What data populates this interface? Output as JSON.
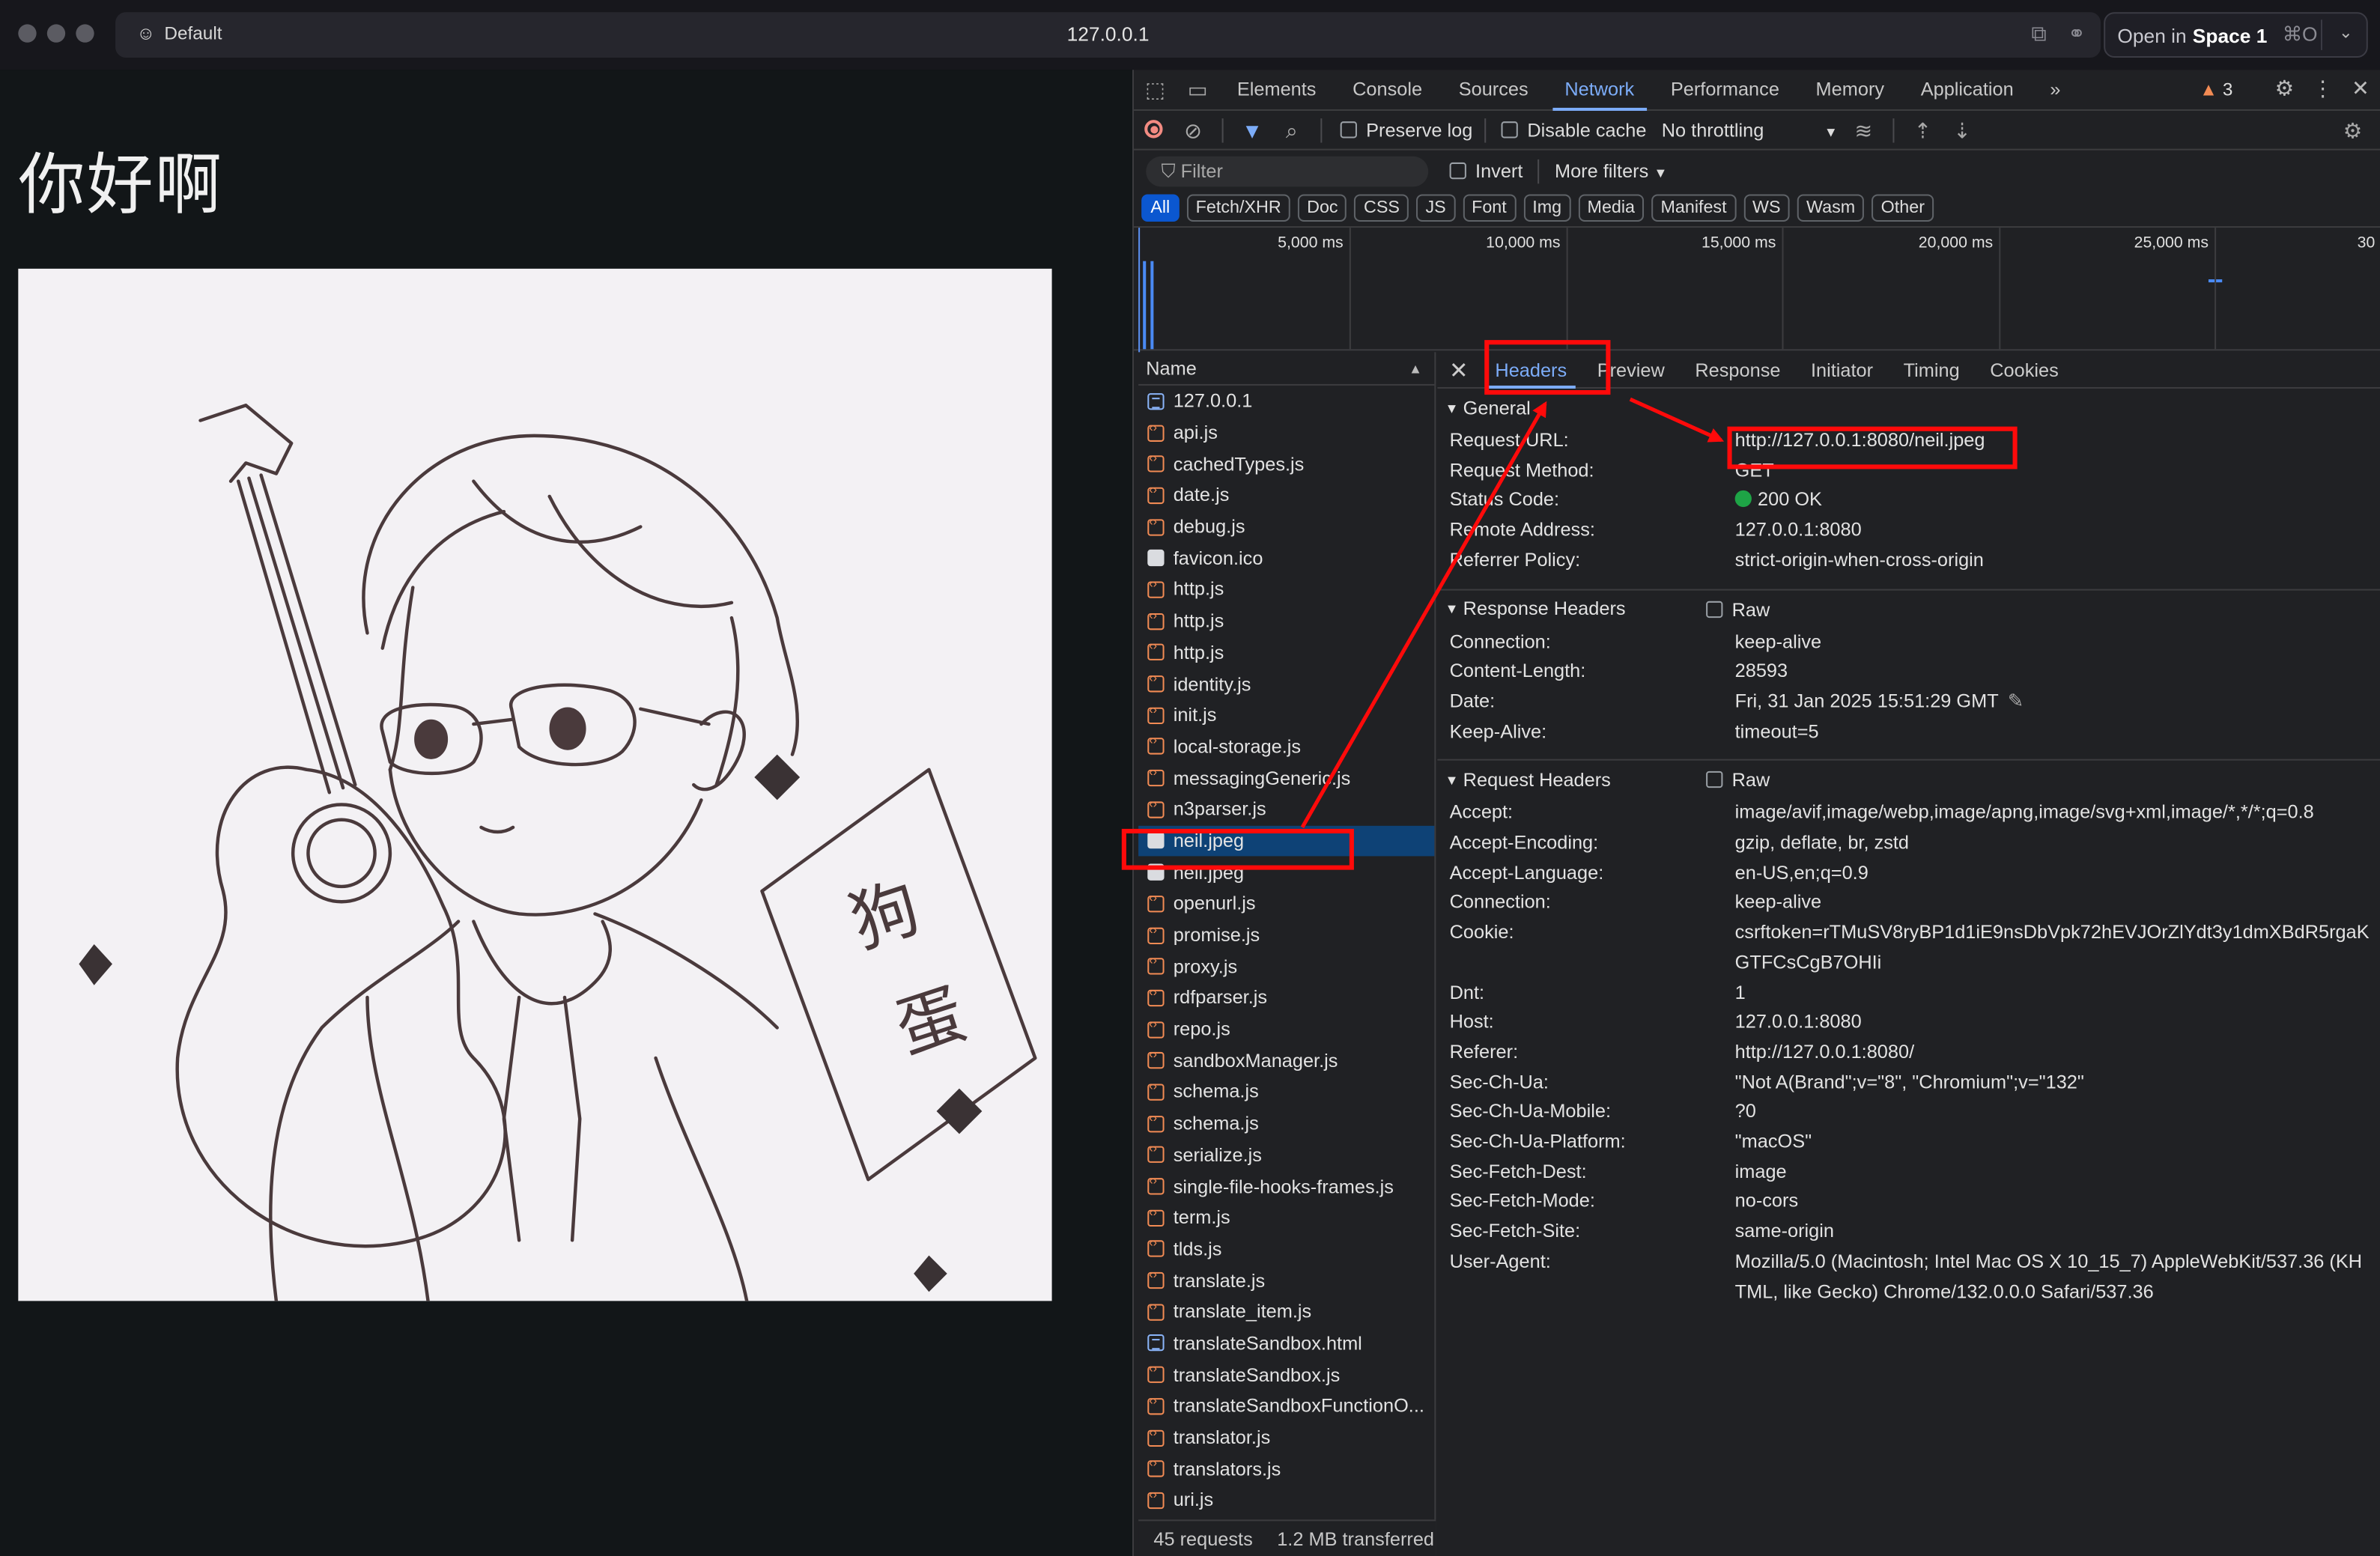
{
  "browser": {
    "profile": "Default",
    "url": "127.0.0.1",
    "open_in_label": "Open in",
    "open_in_space": "Space 1",
    "open_in_shortcut": "⌘O"
  },
  "page": {
    "heading": "你好啊",
    "artwork_text": "狗蛋"
  },
  "devtools": {
    "tabs": [
      "Elements",
      "Console",
      "Sources",
      "Network",
      "Performance",
      "Memory",
      "Application"
    ],
    "active_tab": "Network",
    "issues_count": "3",
    "toolbar": {
      "preserve_log": "Preserve log",
      "disable_cache": "Disable cache",
      "throttling": "No throttling"
    },
    "filter": {
      "placeholder": "Filter",
      "invert": "Invert",
      "more_filters": "More filters"
    },
    "type_filters": [
      "All",
      "Fetch/XHR",
      "Doc",
      "CSS",
      "JS",
      "Font",
      "Img",
      "Media",
      "Manifest",
      "WS",
      "Wasm",
      "Other"
    ],
    "timeline_ticks": [
      "5,000 ms",
      "10,000 ms",
      "15,000 ms",
      "20,000 ms",
      "25,000 ms",
      "30"
    ],
    "name_header": "Name",
    "requests": [
      {
        "name": "127.0.0.1",
        "type": "doc"
      },
      {
        "name": "api.js",
        "type": "js"
      },
      {
        "name": "cachedTypes.js",
        "type": "js"
      },
      {
        "name": "date.js",
        "type": "js"
      },
      {
        "name": "debug.js",
        "type": "js"
      },
      {
        "name": "favicon.ico",
        "type": "img"
      },
      {
        "name": "http.js",
        "type": "js"
      },
      {
        "name": "http.js",
        "type": "js"
      },
      {
        "name": "http.js",
        "type": "js"
      },
      {
        "name": "identity.js",
        "type": "js"
      },
      {
        "name": "init.js",
        "type": "js"
      },
      {
        "name": "local-storage.js",
        "type": "js"
      },
      {
        "name": "messagingGeneric.js",
        "type": "js"
      },
      {
        "name": "n3parser.js",
        "type": "js"
      },
      {
        "name": "neil.jpeg",
        "type": "img",
        "selected": true
      },
      {
        "name": "neil.jpeg",
        "type": "img"
      },
      {
        "name": "openurl.js",
        "type": "js"
      },
      {
        "name": "promise.js",
        "type": "js"
      },
      {
        "name": "proxy.js",
        "type": "js"
      },
      {
        "name": "rdfparser.js",
        "type": "js"
      },
      {
        "name": "repo.js",
        "type": "js"
      },
      {
        "name": "sandboxManager.js",
        "type": "js"
      },
      {
        "name": "schema.js",
        "type": "js"
      },
      {
        "name": "schema.js",
        "type": "js"
      },
      {
        "name": "serialize.js",
        "type": "js"
      },
      {
        "name": "single-file-hooks-frames.js",
        "type": "js"
      },
      {
        "name": "term.js",
        "type": "js"
      },
      {
        "name": "tlds.js",
        "type": "js"
      },
      {
        "name": "translate.js",
        "type": "js"
      },
      {
        "name": "translate_item.js",
        "type": "js"
      },
      {
        "name": "translateSandbox.html",
        "type": "doc"
      },
      {
        "name": "translateSandbox.js",
        "type": "js"
      },
      {
        "name": "translateSandboxFunctionO...",
        "type": "js"
      },
      {
        "name": "translator.js",
        "type": "js"
      },
      {
        "name": "translators.js",
        "type": "js"
      },
      {
        "name": "uri.js",
        "type": "js"
      }
    ],
    "summary": {
      "requests": "45 requests",
      "transferred": "1.2 MB transferred"
    },
    "detail_tabs": [
      "Headers",
      "Preview",
      "Response",
      "Initiator",
      "Timing",
      "Cookies"
    ],
    "general": {
      "title": "General",
      "rows": [
        {
          "k": "Request URL:",
          "v": "http://127.0.0.1:8080/neil.jpeg"
        },
        {
          "k": "Request Method:",
          "v": "GET"
        },
        {
          "k": "Status Code:",
          "v": "200 OK"
        },
        {
          "k": "Remote Address:",
          "v": "127.0.0.1:8080"
        },
        {
          "k": "Referrer Policy:",
          "v": "strict-origin-when-cross-origin"
        }
      ]
    },
    "response_headers": {
      "title": "Response Headers",
      "raw": "Raw",
      "rows": [
        {
          "k": "Connection:",
          "v": "keep-alive"
        },
        {
          "k": "Content-Length:",
          "v": "28593"
        },
        {
          "k": "Date:",
          "v": "Fri, 31 Jan 2025 15:51:29 GMT"
        },
        {
          "k": "Keep-Alive:",
          "v": "timeout=5"
        }
      ]
    },
    "request_headers": {
      "title": "Request Headers",
      "raw": "Raw",
      "rows": [
        {
          "k": "Accept:",
          "v": "image/avif,image/webp,image/apng,image/svg+xml,image/*,*/*;q=0.8"
        },
        {
          "k": "Accept-Encoding:",
          "v": "gzip, deflate, br, zstd"
        },
        {
          "k": "Accept-Language:",
          "v": "en-US,en;q=0.9"
        },
        {
          "k": "Connection:",
          "v": "keep-alive"
        },
        {
          "k": "Cookie:",
          "v": "csrftoken=rTMuSV8ryBP1d1iE9nsDbVpk72hEVJOrZlYdt3y1dmXBdR5rgaKGTFCsCgB7OHIi"
        },
        {
          "k": "Dnt:",
          "v": "1"
        },
        {
          "k": "Host:",
          "v": "127.0.0.1:8080"
        },
        {
          "k": "Referer:",
          "v": "http://127.0.0.1:8080/"
        },
        {
          "k": "Sec-Ch-Ua:",
          "v": "\"Not A(Brand\";v=\"8\", \"Chromium\";v=\"132\""
        },
        {
          "k": "Sec-Ch-Ua-Mobile:",
          "v": "?0"
        },
        {
          "k": "Sec-Ch-Ua-Platform:",
          "v": "\"macOS\""
        },
        {
          "k": "Sec-Fetch-Dest:",
          "v": "image"
        },
        {
          "k": "Sec-Fetch-Mode:",
          "v": "no-cors"
        },
        {
          "k": "Sec-Fetch-Site:",
          "v": "same-origin"
        },
        {
          "k": "User-Agent:",
          "v": "Mozilla/5.0 (Macintosh; Intel Mac OS X 10_15_7) AppleWebKit/537.36 (KHTML, like Gecko) Chrome/132.0.0.0 Safari/537.36"
        }
      ]
    }
  },
  "colors": {
    "accent": "#7cacf8",
    "annotation": "#ff0a0a",
    "status_ok": "#1ea446"
  }
}
